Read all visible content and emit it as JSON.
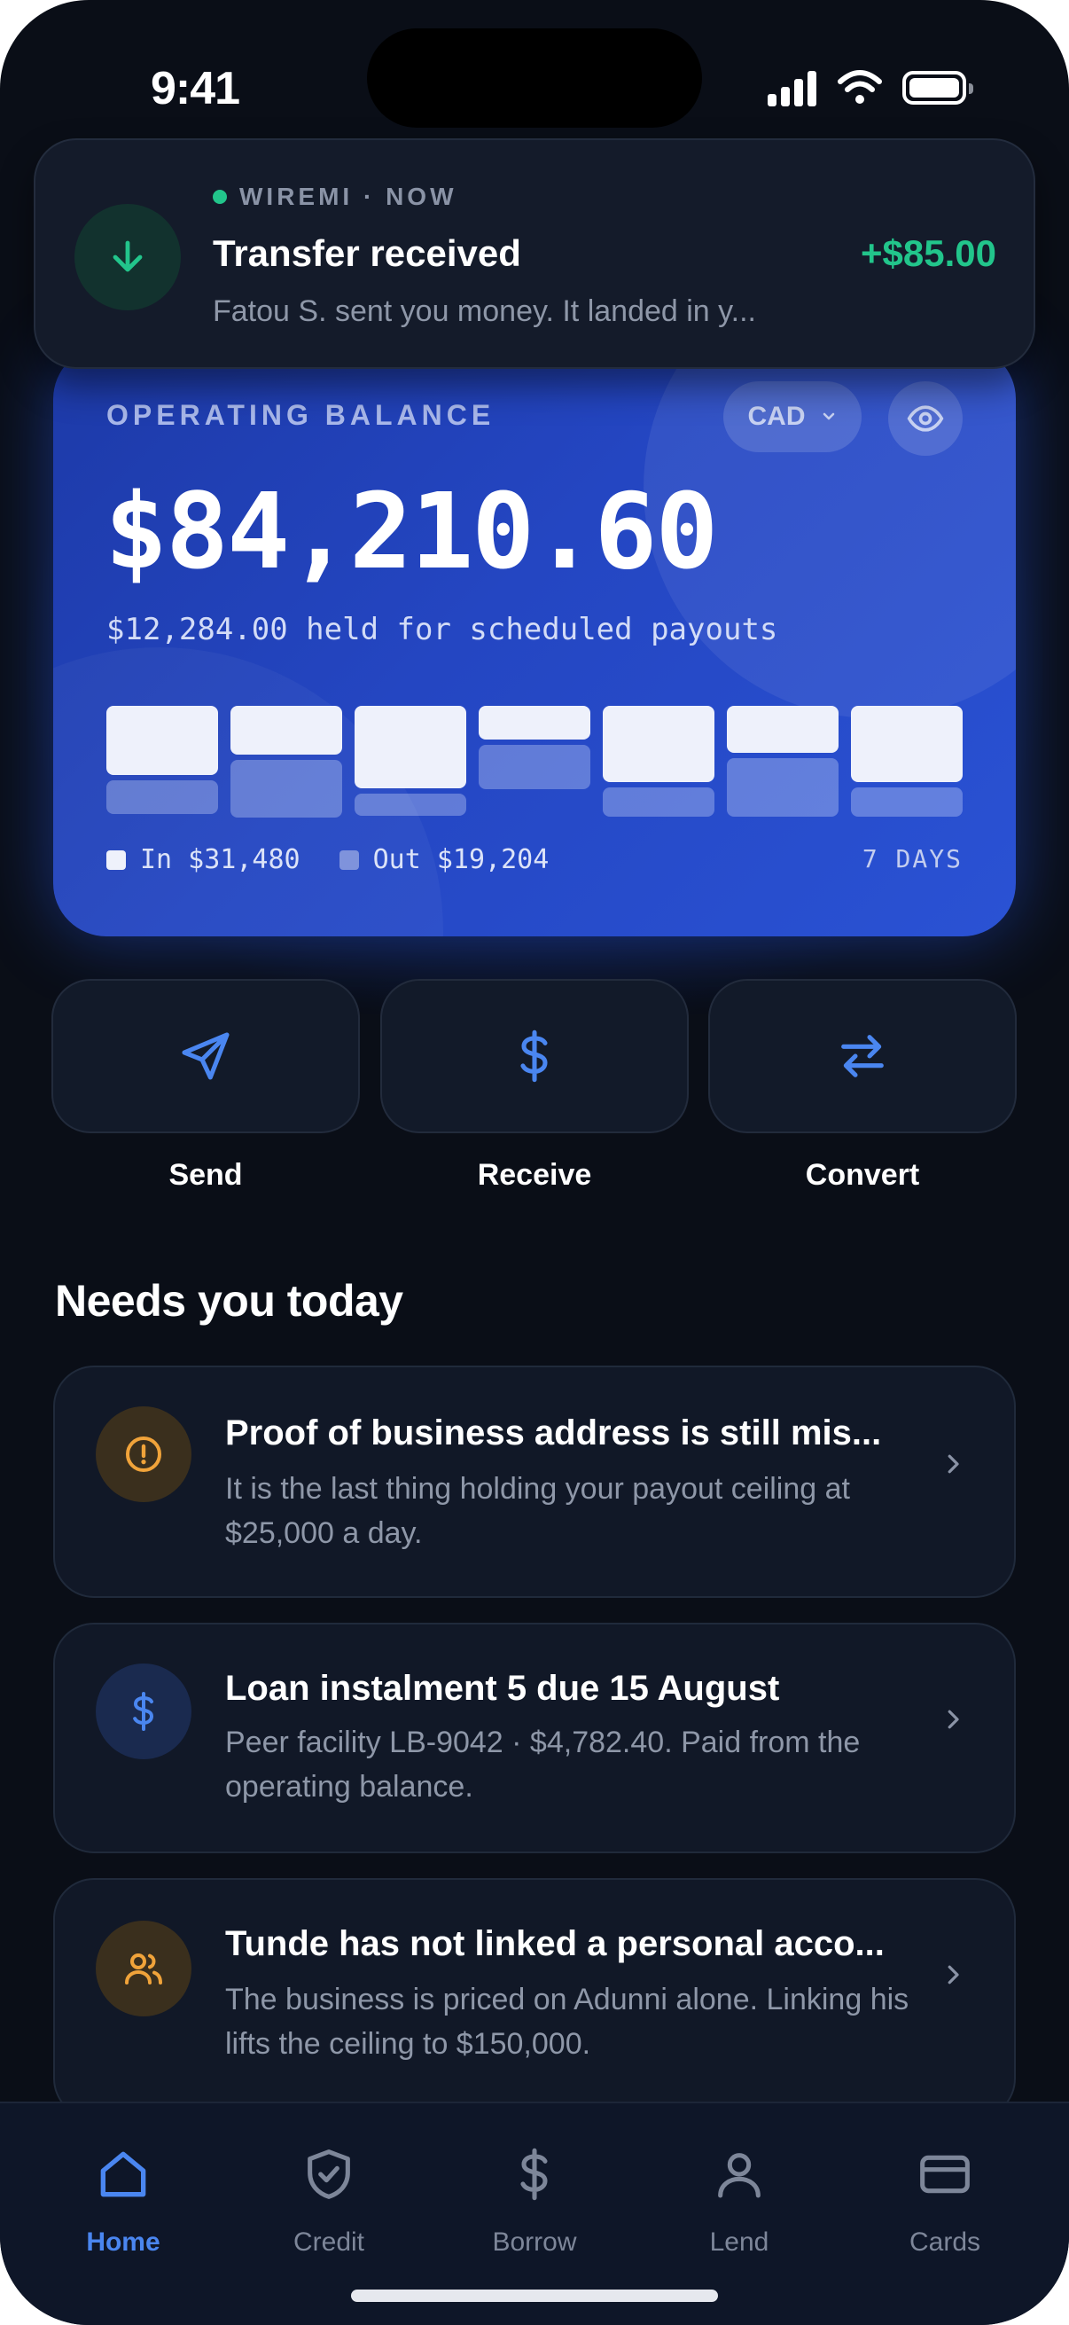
{
  "status_bar": {
    "time": "9:41"
  },
  "notification": {
    "app": "WIREMI · NOW",
    "title": "Transfer received",
    "amount": "+$85.00",
    "body": "Fatou S. sent you money. It landed in y..."
  },
  "balance_card": {
    "label": "OPERATING BALANCE",
    "currency": "CAD",
    "amount": "$84,210.60",
    "held": "$12,284.00 held for scheduled payouts",
    "legend_in": "In $31,480",
    "legend_out": "Out $19,204",
    "period": "7 DAYS",
    "chart": {
      "days": 7,
      "in_levels": [
        0.62,
        0.44,
        0.74,
        0.3,
        0.68,
        0.42,
        0.68
      ],
      "out_levels": [
        0.3,
        0.52,
        0.2,
        0.4,
        0.26,
        0.52,
        0.26
      ]
    }
  },
  "actions": [
    {
      "label": "Send",
      "icon": "send-icon"
    },
    {
      "label": "Receive",
      "icon": "dollar-icon"
    },
    {
      "label": "Convert",
      "icon": "convert-icon"
    }
  ],
  "section_title": "Needs you today",
  "tasks": [
    {
      "title": "Proof of business address is still mis...",
      "body": "It is the last thing holding your payout ceiling at $25,000 a day.",
      "icon": "alert-icon",
      "color": "#f0a33a"
    },
    {
      "title": "Loan instalment 5 due 15 August",
      "body": "Peer facility LB-9042 · $4,782.40. Paid from the operating balance.",
      "icon": "dollar-icon",
      "color": "#4a86f0"
    },
    {
      "title": "Tunde has not linked a personal acco...",
      "body": "The business is priced on Adunni alone. Linking his lifts the ceiling to $150,000.",
      "icon": "users-icon",
      "color": "#f0a33a"
    }
  ],
  "tabs": [
    {
      "label": "Home",
      "active": true
    },
    {
      "label": "Credit",
      "active": false
    },
    {
      "label": "Borrow",
      "active": false
    },
    {
      "label": "Lend",
      "active": false
    },
    {
      "label": "Cards",
      "active": false
    }
  ],
  "colors": {
    "accent": "#4a86f0",
    "positive": "#22c58b",
    "warning": "#f0a33a",
    "background": "#0a0e17"
  }
}
